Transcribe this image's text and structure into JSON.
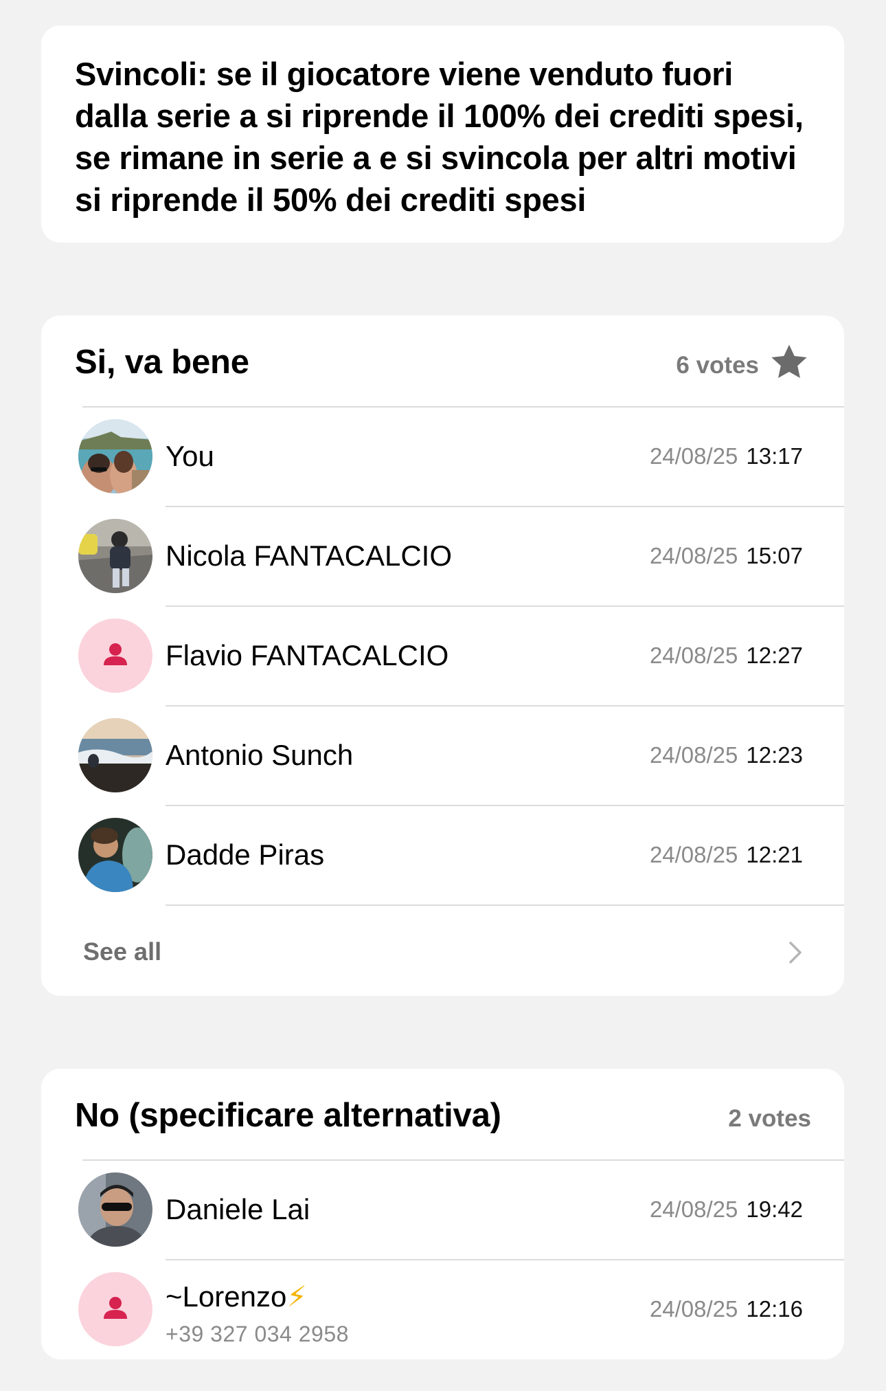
{
  "question": {
    "text": "Svincoli: se il giocatore viene venduto fuori dalla serie a si riprende il 100% dei crediti spesi, se rimane in serie a e si svincola per altri motivi si riprende il 50% dei crediti spesi"
  },
  "options": [
    {
      "title": "Si, va bene",
      "votes_label": "6 votes",
      "starred": true,
      "icon": "star-icon",
      "voters": [
        {
          "name": "You",
          "date": "24/08/25",
          "time": "13:17",
          "avatar": "photo-couple-seaside"
        },
        {
          "name": "Nicola FANTACALCIO",
          "date": "24/08/25",
          "time": "15:07",
          "avatar": "photo-child-walking"
        },
        {
          "name": "Flavio FANTACALCIO",
          "date": "24/08/25",
          "time": "12:27",
          "avatar": "default-person-icon"
        },
        {
          "name": "Antonio Sunch",
          "date": "24/08/25",
          "time": "12:23",
          "avatar": "photo-sea-sunset"
        },
        {
          "name": "Dadde Piras",
          "date": "24/08/25",
          "time": "12:21",
          "avatar": "photo-man-cave"
        }
      ],
      "see_all_label": "See all"
    },
    {
      "title": "No (specificare alternativa)",
      "votes_label": "2 votes",
      "starred": false,
      "voters": [
        {
          "name": "Daniele Lai",
          "date": "24/08/25",
          "time": "19:42",
          "avatar": "photo-man-sunglasses"
        },
        {
          "name": "~Lorenzo",
          "emoji": "⚡",
          "phone": "+39 327 034 2958",
          "date": "24/08/25",
          "time": "12:16",
          "avatar": "default-person-icon"
        }
      ]
    }
  ],
  "colors": {
    "background": "#f2f2f2",
    "card": "#ffffff",
    "secondary_text": "#8a8a8a",
    "default_avatar_bg": "#fbd3dc",
    "default_avatar_fg": "#d6234f"
  }
}
